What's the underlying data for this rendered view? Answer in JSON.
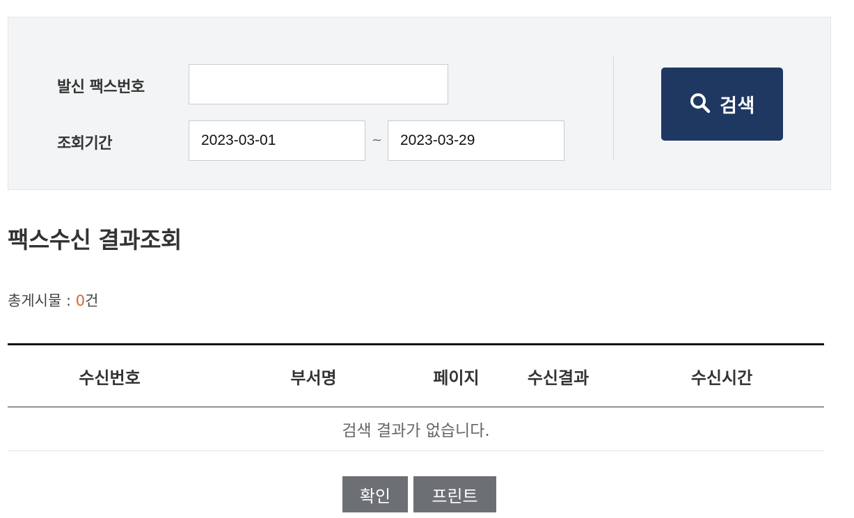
{
  "search": {
    "fax_label": "발신 팩스번호",
    "fax_value": "",
    "period_label": "조회기간",
    "date_from": "2023-03-01",
    "date_separator": "~",
    "date_to": "2023-03-29",
    "button_label": "검색",
    "button_icon": "search-icon",
    "button_color": "#1f3862"
  },
  "page": {
    "title": "팩스수신 결과조회"
  },
  "summary": {
    "label": "총게시물 : ",
    "count": "0",
    "unit": "건",
    "count_color": "#d3692b"
  },
  "table": {
    "headers": [
      "수신번호",
      "부서명",
      "페이지",
      "수신결과",
      "수신시간"
    ],
    "empty_message": "검색 결과가 없습니다."
  },
  "actions": {
    "confirm_label": "확인",
    "print_label": "프린트"
  }
}
